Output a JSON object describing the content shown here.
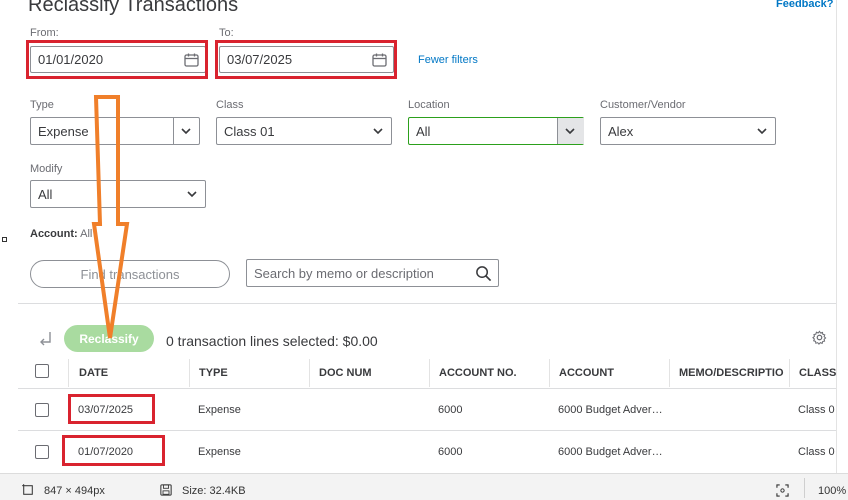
{
  "page": {
    "title": "Reclassify Transactions",
    "feedback_link": "Feedback?"
  },
  "filters": {
    "from_label": "From:",
    "from_value": "01/01/2020",
    "to_label": "To:",
    "to_value": "03/07/2025",
    "fewer_filters": "Fewer filters",
    "type_label": "Type",
    "type_value": "Expense",
    "class_label": "Class",
    "class_value": "Class 01",
    "location_label": "Location",
    "location_value": "All",
    "customer_label": "Customer/Vendor",
    "customer_value": "Alex",
    "modify_label": "Modify",
    "modify_value": "All",
    "account_label": "Account:",
    "account_value": "All"
  },
  "actions": {
    "find_button": "Find transactions",
    "search_placeholder": "Search by memo or description",
    "reclassify_button": "Reclassify",
    "selection_summary": "0 transaction lines selected: $0.00"
  },
  "table": {
    "headers": [
      "DATE",
      "TYPE",
      "DOC NUM",
      "ACCOUNT NO.",
      "ACCOUNT",
      "MEMO/DESCRIPTIO",
      "CLASS"
    ],
    "rows": [
      {
        "date": "03/07/2025",
        "type": "Expense",
        "doc_num": "",
        "account_no": "6000",
        "account": "6000 Budget Adver…",
        "memo": "",
        "class": "Class 0"
      },
      {
        "date": "01/07/2020",
        "type": "Expense",
        "doc_num": "",
        "account_no": "6000",
        "account": "6000 Budget Adver…",
        "memo": "",
        "class": "Class 0"
      }
    ]
  },
  "statusbar": {
    "dimensions": "847 × 494px",
    "size": "Size: 32.4KB",
    "zoom": "100%"
  },
  "colors": {
    "annotation_red": "#d9232f",
    "annotation_orange": "#f07f2a",
    "link_blue": "#0077c5",
    "reclassify_green": "#a9dba0"
  }
}
